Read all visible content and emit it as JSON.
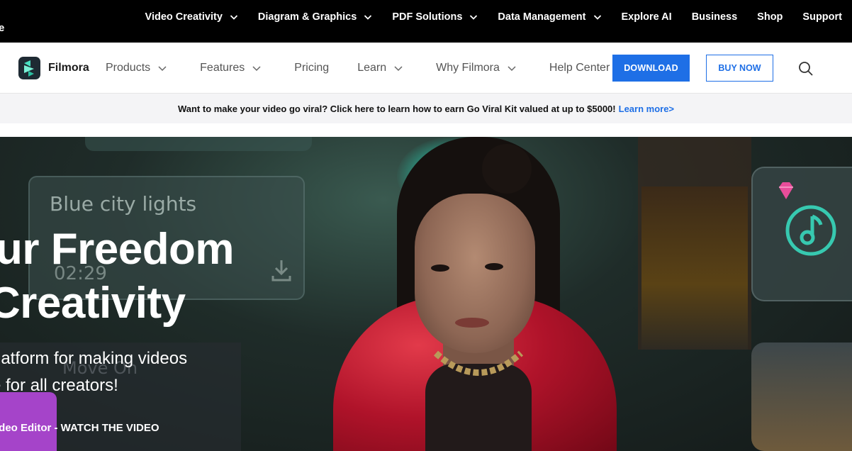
{
  "topbar": {
    "edge_text": "e",
    "items": [
      {
        "label": "Video Creativity",
        "dropdown": true
      },
      {
        "label": "Diagram & Graphics",
        "dropdown": true
      },
      {
        "label": "PDF Solutions",
        "dropdown": true
      },
      {
        "label": "Data Management",
        "dropdown": true
      },
      {
        "label": "Explore AI",
        "dropdown": false
      },
      {
        "label": "Business",
        "dropdown": false
      },
      {
        "label": "Shop",
        "dropdown": false
      },
      {
        "label": "Support",
        "dropdown": false
      }
    ]
  },
  "header": {
    "logo_text": "Filmora",
    "nav": [
      {
        "label": "Products",
        "dropdown": true
      },
      {
        "label": "Features",
        "dropdown": true
      },
      {
        "label": "Pricing",
        "dropdown": false
      },
      {
        "label": "Learn",
        "dropdown": true
      },
      {
        "label": "Why Filmora",
        "dropdown": true
      },
      {
        "label": "Help Center",
        "dropdown": true
      }
    ],
    "download_label": "DOWNLOAD",
    "buy_label": "BUY NOW",
    "search_icon": "search-icon"
  },
  "promo": {
    "text": "Want to make your video go viral? Click here to learn how to earn Go Viral Kit valued at up to $5000!",
    "link": "Learn more>"
  },
  "hero": {
    "title_line1": "ur Freedom",
    "title_line2": "Creativity",
    "subtitle_line1": "latform for making videos",
    "subtitle_line2": "e for all creators!",
    "watch_text": "ideo Editor - WATCH THE VIDEO",
    "panel_label": "Blue city lights",
    "panel_time": "02:29",
    "movie_label": "Move On"
  },
  "colors": {
    "accent": "#1e6fe6",
    "topbar_bg": "#000000",
    "promo_bg": "#f4f4f6"
  }
}
